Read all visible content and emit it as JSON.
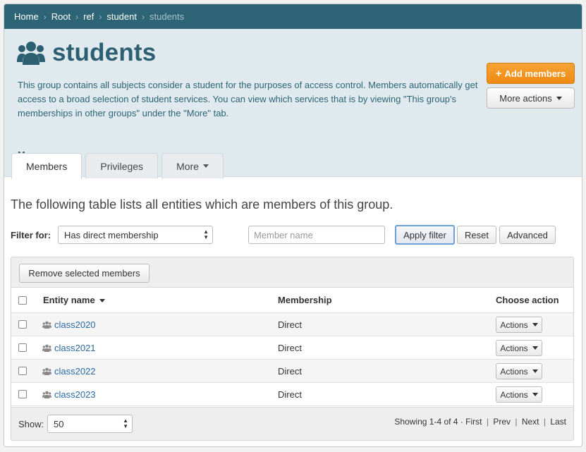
{
  "breadcrumb": {
    "items": [
      "Home",
      "Root",
      "ref",
      "student"
    ],
    "current": "students"
  },
  "header": {
    "title": "students",
    "icon": "group-icon",
    "description": "This group contains all subjects consider a student for the purposes of access control. Members automatically get access to a broad selection of student services. You can view which services that is by viewing \"This group's memberships in other groups\" under the \"More\" tab.",
    "more_label": "More",
    "add_members_label": "Add members",
    "more_actions_label": "More actions"
  },
  "tabs": [
    {
      "label": "Members",
      "active": true
    },
    {
      "label": "Privileges",
      "active": false
    },
    {
      "label": "More",
      "active": false
    }
  ],
  "main": {
    "intro": "The following table lists all entities which are members of this group.",
    "filter_label": "Filter for:",
    "filter_value": "Has direct membership",
    "member_name_placeholder": "Member name",
    "apply_filter_label": "Apply filter",
    "reset_label": "Reset",
    "advanced_label": "Advanced"
  },
  "table": {
    "remove_label": "Remove selected members",
    "headers": {
      "entity": "Entity name",
      "membership": "Membership",
      "action": "Choose action"
    },
    "rows": [
      {
        "name": "class2020",
        "membership": "Direct",
        "action": "Actions"
      },
      {
        "name": "class2021",
        "membership": "Direct",
        "action": "Actions"
      },
      {
        "name": "class2022",
        "membership": "Direct",
        "action": "Actions"
      },
      {
        "name": "class2023",
        "membership": "Direct",
        "action": "Actions"
      }
    ],
    "show_label": "Show:",
    "page_size": "50",
    "pager": {
      "summary": "Showing 1-4 of 4",
      "first": "First",
      "prev": "Prev",
      "next": "Next",
      "last": "Last"
    }
  },
  "colors": {
    "breadcrumb_bg": "#2d6576",
    "header_bg": "#dfe9ee",
    "title": "#2b5f71",
    "add_button": "#ee8a10",
    "link": "#2a6aa5"
  }
}
